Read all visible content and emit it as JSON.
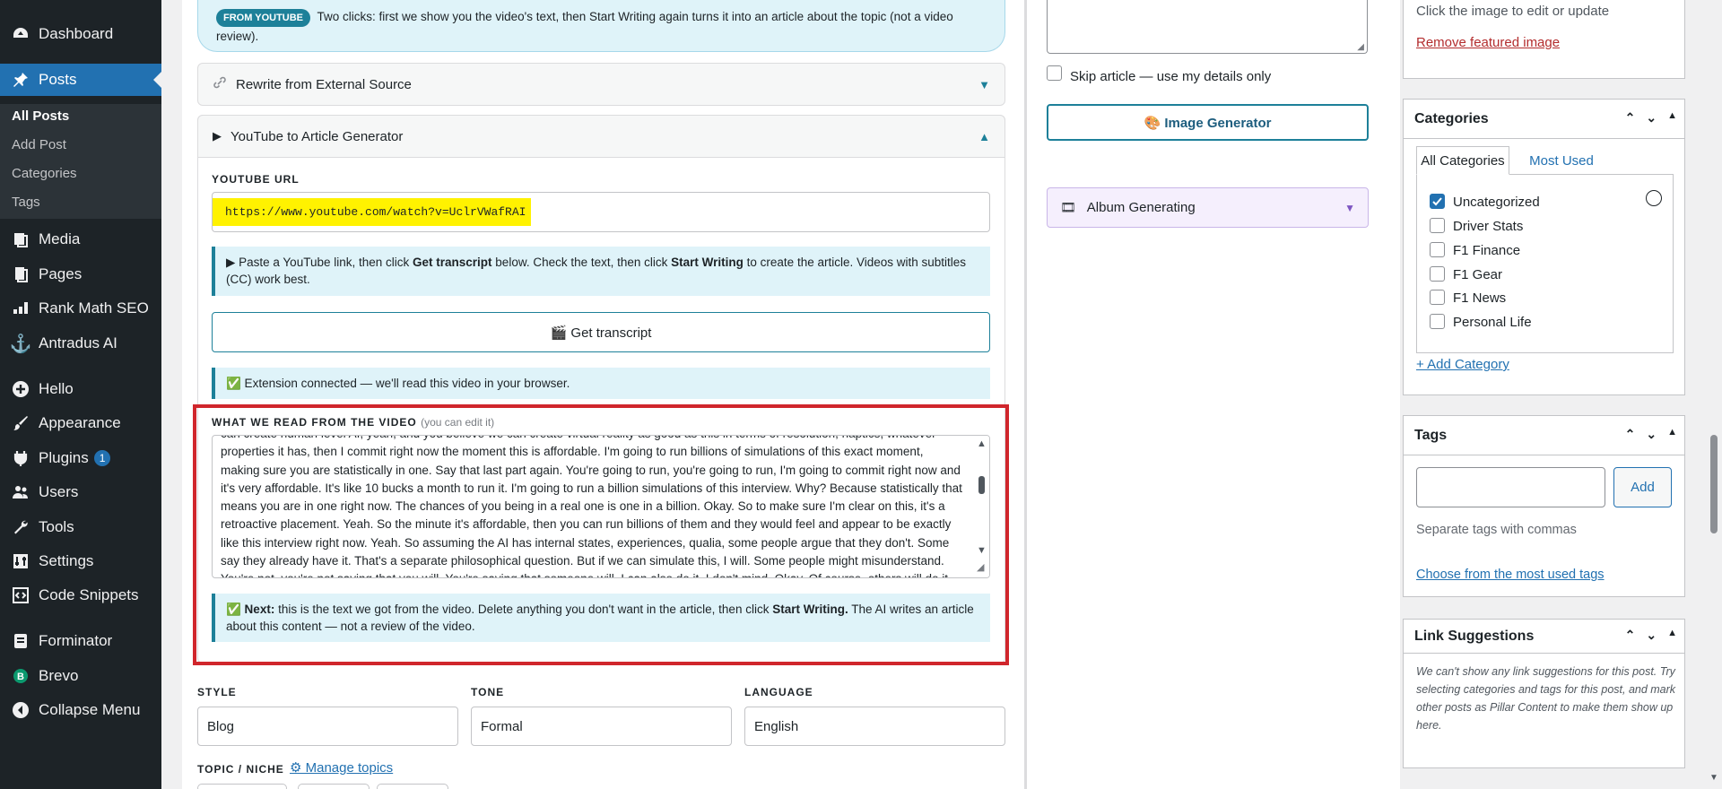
{
  "sidebar": {
    "items": [
      {
        "label": "Dashboard",
        "icon": "dashboard-icon"
      },
      {
        "label": "Posts",
        "icon": "pushpin-icon"
      },
      {
        "label": "Media",
        "icon": "media-icon"
      },
      {
        "label": "Pages",
        "icon": "pages-icon"
      },
      {
        "label": "Rank Math SEO",
        "icon": "rank-math-icon"
      },
      {
        "label": "Antradus AI",
        "icon": "anchor-icon"
      },
      {
        "label": "Hello",
        "icon": "plus-circle-icon"
      },
      {
        "label": "Appearance",
        "icon": "paintbrush-icon"
      },
      {
        "label": "Plugins",
        "icon": "plug-icon",
        "badge": "1"
      },
      {
        "label": "Users",
        "icon": "users-icon"
      },
      {
        "label": "Tools",
        "icon": "wrench-icon"
      },
      {
        "label": "Settings",
        "icon": "settings-icon"
      },
      {
        "label": "Code Snippets",
        "icon": "code-icon"
      },
      {
        "label": "Forminator",
        "icon": "forminator-icon"
      },
      {
        "label": "Brevo",
        "icon": "brevo-icon"
      },
      {
        "label": "Collapse Menu",
        "icon": "collapse-icon"
      }
    ],
    "submenu": [
      "All Posts",
      "Add Post",
      "Categories",
      "Tags"
    ]
  },
  "main": {
    "youtube_note": {
      "pill": "FROM YOUTUBE",
      "text": "Two clicks: first we show you the video's text, then Start Writing again turns it into an article about the topic (not a video review)."
    },
    "rewrite_section": {
      "title": "Rewrite from External Source"
    },
    "yt_section": {
      "title": "YouTube to Article Generator"
    },
    "youtube_url_label": "YOUTUBE URL",
    "youtube_url_value": "https://www.youtube.com/watch?v=UclrVWafRAI",
    "paste_tip": {
      "t1": "▶ Paste a YouTube link, then click ",
      "b1": "Get transcript",
      "t2": " below. Check the text, then click ",
      "b2": "Start Writing",
      "t3": " to create the article. Videos with subtitles (CC) work best."
    },
    "get_transcript_label": "🎬 Get transcript",
    "extension_status": "✅ Extension connected — we'll read this video in your browser.",
    "transcript_label": "WHAT WE READ FROM THE VIDEO",
    "transcript_hint": "(you can edit it)",
    "transcript_text": "can create human level AI, yeah, and you believe we can create virtual reality as good as this in terms of resolution, haptics, whatever properties it has, then I commit right now the moment this is affordable. I'm going to run billions of simulations of this exact moment, making sure you are statistically in one. Say that last part again. You're going to run, you're going to run, I'm going to commit right now and it's very affordable. It's like 10 bucks a month to run it. I'm going to run a billion simulations of this interview. Why? Because statistically that means you are in one right now. The chances of you being in a real one is one in a billion. Okay. So to make sure I'm clear on this, it's a retroactive placement. Yeah. So the minute it's affordable, then you can run billions of them and they would feel and appear to be exactly like this interview right now. Yeah. So assuming the AI has internal states, experiences, qualia, some people argue that they don't. Some say they already have it. That's a separate philosophical question. But if we can simulate this, I will. Some people might misunderstand. You're not, you're not saying that you will. You're saying that someone will. I can also do it. I don't mind. Okay. Of course, others will do it before I",
    "next_tip": {
      "b1": "✅ Next:",
      "t1": " this is the text we got from the video. Delete anything you don't want in the article, then click ",
      "b2": "Start Writing.",
      "t2": " The AI writes an article about this content — not a review of the video."
    },
    "style": {
      "label": "STYLE",
      "value": "Blog"
    },
    "tone": {
      "label": "TONE",
      "value": "Formal"
    },
    "language": {
      "label": "LANGUAGE",
      "value": "English"
    },
    "topic_label": "TOPIC / NICHE",
    "manage_topics": "⚙ Manage topics"
  },
  "middle": {
    "skip_label": "Skip article — use my details only",
    "image_gen_label": "🎨 Image Generator",
    "album_label": "Album Generating",
    "album_icon": "film-icon"
  },
  "right": {
    "featured": {
      "hint": "Click the image to edit or update",
      "remove": "Remove featured image"
    },
    "categories": {
      "title": "Categories",
      "tab_all": "All Categories",
      "tab_most": "Most Used",
      "items": [
        {
          "label": "Uncategorized",
          "checked": true
        },
        {
          "label": "Driver Stats",
          "checked": false
        },
        {
          "label": "F1 Finance",
          "checked": false
        },
        {
          "label": "F1 Gear",
          "checked": false
        },
        {
          "label": "F1 News",
          "checked": false
        },
        {
          "label": "Personal Life",
          "checked": false
        }
      ],
      "add": "+ Add Category"
    },
    "tags": {
      "title": "Tags",
      "add_btn": "Add",
      "hint": "Separate tags with commas",
      "choose": "Choose from the most used tags"
    },
    "links": {
      "title": "Link Suggestions",
      "text": "We can't show any link suggestions for this post. Try selecting categories and tags for this post, and mark other posts as Pillar Content to make them show up here."
    }
  },
  "colors": {
    "accent": "#2271b1",
    "teal": "#1d8099",
    "highlight": "#fff200",
    "red_box": "#d0262c",
    "sidebar": "#1d2327"
  }
}
